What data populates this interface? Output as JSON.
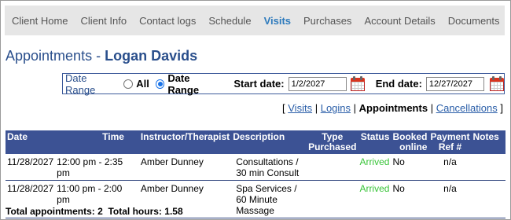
{
  "nav": {
    "tabs": [
      {
        "label": "Client Home"
      },
      {
        "label": "Client Info"
      },
      {
        "label": "Contact logs"
      },
      {
        "label": "Schedule"
      },
      {
        "label": "Visits",
        "active": true
      },
      {
        "label": "Purchases"
      },
      {
        "label": "Account Details"
      },
      {
        "label": "Documents"
      }
    ]
  },
  "page": {
    "title": "Appointments",
    "dash": " - ",
    "client_name": "Logan Davids"
  },
  "filter": {
    "date_range_label": "Date Range",
    "options": [
      "All",
      "Date Range"
    ],
    "selected": "Date Range",
    "start_label": "Start date:",
    "start_value": "1/2/2027",
    "end_label": "End date:",
    "end_value": "12/27/2027"
  },
  "links": {
    "items": [
      "Visits",
      "Logins",
      "Appointments",
      "Cancellations"
    ],
    "current": "Appointments",
    "separator": "|",
    "open_bracket": "[",
    "close_bracket": "]"
  },
  "table": {
    "headers": {
      "date": "Date",
      "time": "Time",
      "instructor": "Instructor/Therapist",
      "description": "Description",
      "type_purchased": "Type Purchased",
      "status": "Status",
      "booked_online": "Booked online",
      "payment_ref": "Payment Ref #",
      "notes": "Notes"
    },
    "rows": [
      {
        "date": "11/28/2027",
        "time": "12:00 pm - 2:35 pm",
        "instructor": "Amber Dunney",
        "description": "Consultations / 30 min Consult",
        "type_purchased": "",
        "status": "Arrived",
        "booked_online": "No",
        "payment_ref": "n/a",
        "notes": ""
      },
      {
        "date": "11/28/2027",
        "time": "11:00 pm - 2:00 pm",
        "instructor": "Amber Dunney",
        "description": "Spa Services / 60 Minute Massage",
        "type_purchased": "",
        "status": "Arrived",
        "booked_online": "No",
        "payment_ref": "n/a",
        "notes": ""
      }
    ]
  },
  "totals": {
    "appointments_label": "Total appointments:",
    "appointments_value": "2",
    "hours_label": "Total hours:",
    "hours_value": "1.58"
  },
  "colors": {
    "header_bg": "#3c5294",
    "title": "#2a4f8c",
    "active_tab": "#2e7bbd",
    "arrived": "#39c439",
    "link": "#2a5ea8"
  }
}
